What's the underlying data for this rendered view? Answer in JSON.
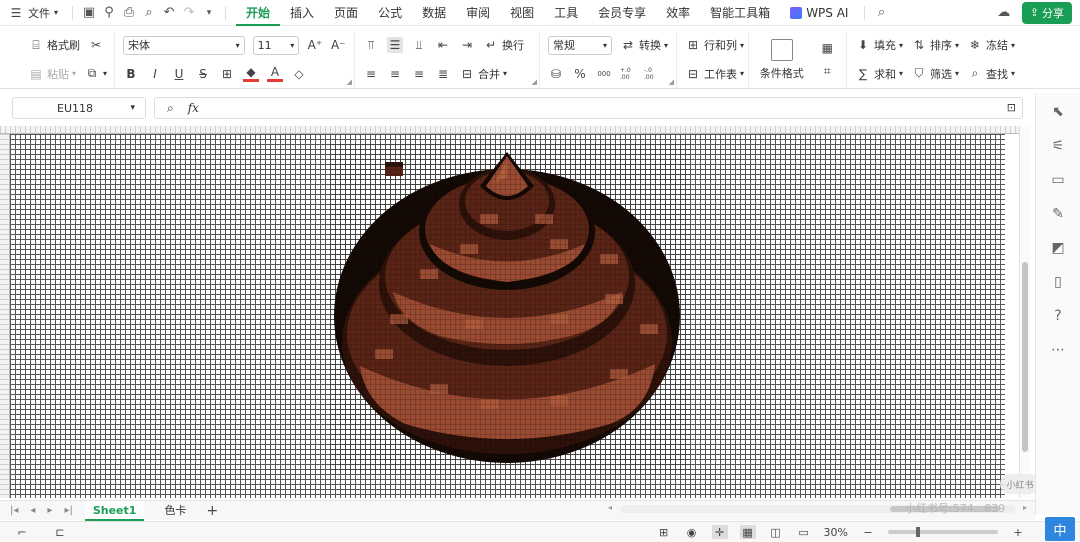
{
  "menubar": {
    "file_label": "文件",
    "tabs": [
      "开始",
      "插入",
      "页面",
      "公式",
      "数据",
      "审阅",
      "视图",
      "工具",
      "会员专享",
      "效率",
      "智能工具箱"
    ],
    "active_tab": "开始",
    "wps_ai_label": "WPS AI",
    "share_label": "分享"
  },
  "ribbon": {
    "format_painter": "格式刷",
    "paste": "粘贴",
    "font_name": "宋体",
    "font_size": "11",
    "wrap_text": "换行",
    "merge": "合并",
    "number_format": "常规",
    "convert": "转换",
    "rows_cols": "行和列",
    "worksheet": "工作表",
    "conditional_format": "条件格式",
    "fill": "填充",
    "sort": "排序",
    "freeze": "冻结",
    "sum": "求和",
    "filter": "筛选",
    "find": "查找",
    "percent_symbol": "%",
    "thousands_symbol": "000",
    "decimal_inc": "+.0 .00",
    "decimal_dec": "-.0 .00",
    "bold": "B",
    "italic": "I",
    "underline": "U",
    "strike": "S"
  },
  "formula_bar": {
    "cell_ref": "EU118",
    "fx_label": "fx",
    "formula": ""
  },
  "sheet_tabs": {
    "tabs": [
      "Sheet1",
      "色卡"
    ],
    "active": "Sheet1",
    "add_label": "+"
  },
  "watermark": {
    "text": "小红书号:574...839",
    "bubble_text": "小红书"
  },
  "statusbar": {
    "zoom": "30%"
  },
  "ime_label": "中",
  "pixel_art": {
    "subject": "poop emoji pixel art",
    "colors": {
      "outline": "#140905",
      "dark": "#2e1209",
      "mid": "#5a2516",
      "light": "#9a4b32",
      "highlight": "#b45e3f"
    }
  }
}
